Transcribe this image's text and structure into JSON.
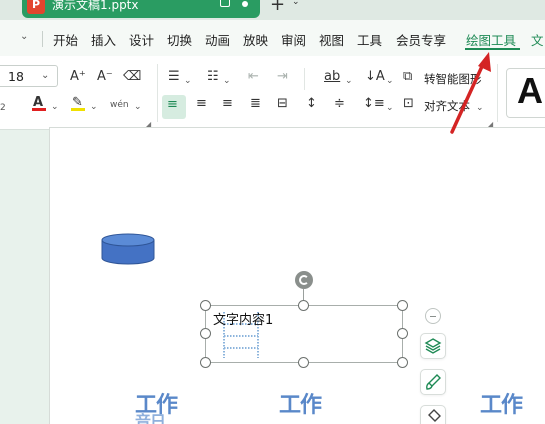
{
  "titlebar": {
    "doc_icon_letter": "P",
    "doc_name": "演示文稿1.pptx",
    "new_tab": "+"
  },
  "menu": {
    "items": [
      "开始",
      "插入",
      "设计",
      "切换",
      "动画",
      "放映",
      "审阅",
      "视图",
      "工具",
      "会员专享",
      "绘图工具",
      "文"
    ],
    "active": "绘图工具"
  },
  "ribbon": {
    "font_size": "18",
    "font_grow": "A⁺",
    "font_shrink": "A⁻",
    "clear_format": "⌫",
    "font_color": "A",
    "highlight": "✎",
    "phonetic": "wén",
    "ab_label": "ab",
    "to_smartart_label": "转智能图形",
    "text_align_label": "对齐文本",
    "style_preview": "A",
    "superscript_hint": "2"
  },
  "canvas": {
    "textbox_text": "文字内容1",
    "wordart_items": [
      "工作",
      "工作",
      "工作"
    ]
  },
  "colors": {
    "accent": "#1e8a55",
    "doc_tab": "#2a9c62",
    "ppt_icon": "#e2452e",
    "arrow": "#d42424",
    "cylinder": "#4472c4"
  }
}
